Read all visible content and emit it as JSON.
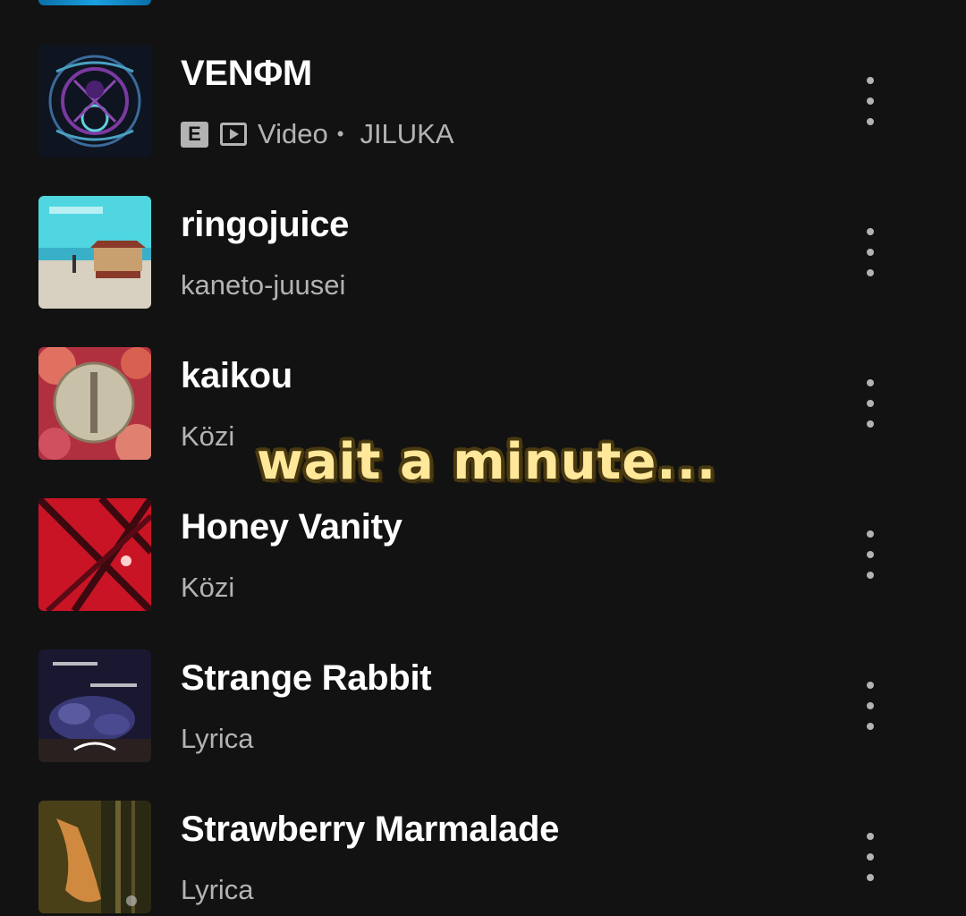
{
  "colors": {
    "background": "#121212",
    "title": "#ffffff",
    "subtitle": "#b3b3b3",
    "overlay_text": "#ffe89a",
    "overlay_outline": "#4a3a10"
  },
  "tracks": [
    {
      "title": "VENΦM",
      "explicit_badge": "E",
      "video_icon": "video-icon",
      "type_label": "Video",
      "separator": "•",
      "artist": "JILUKA",
      "more_icon": "more-vertical-icon"
    },
    {
      "title": "ringojuice",
      "artist": "kaneto-juusei",
      "more_icon": "more-vertical-icon"
    },
    {
      "title": "kaikou",
      "artist": "Közi",
      "more_icon": "more-vertical-icon"
    },
    {
      "title": "Honey Vanity",
      "artist": "Közi",
      "more_icon": "more-vertical-icon"
    },
    {
      "title": "Strange Rabbit",
      "artist": "Lyrica",
      "more_icon": "more-vertical-icon"
    },
    {
      "title": "Strawberry Marmalade",
      "artist": "Lyrica",
      "more_icon": "more-vertical-icon"
    }
  ],
  "overlay": {
    "text": "wait a minute..."
  }
}
